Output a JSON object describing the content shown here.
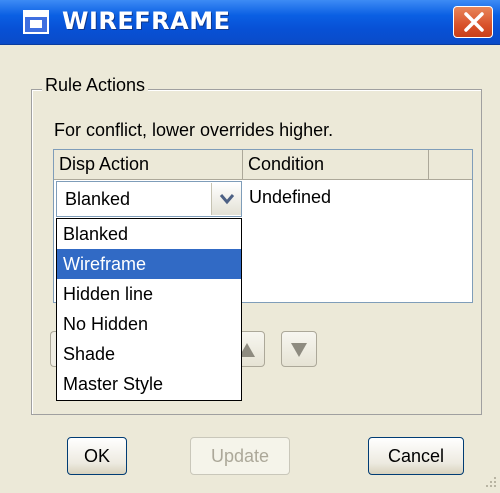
{
  "window": {
    "title": "WIREFRAME",
    "close_icon": "close-x-icon"
  },
  "rule_actions": {
    "group_label": "Rule Actions",
    "hint": "For conflict, lower overrides higher.",
    "columns": [
      "Disp Action",
      "Condition"
    ],
    "row": {
      "disp_action": "Blanked",
      "condition": "Undefined"
    },
    "dropdown": {
      "options": [
        "Blanked",
        "Wireframe",
        "Hidden line",
        "No Hidden",
        "Shade",
        "Master Style"
      ],
      "highlighted": "Wireframe"
    },
    "move_up_icon": "triangle-up-icon",
    "move_down_icon": "triangle-down-icon"
  },
  "buttons": {
    "ok": "OK",
    "update": "Update",
    "cancel": "Cancel"
  }
}
